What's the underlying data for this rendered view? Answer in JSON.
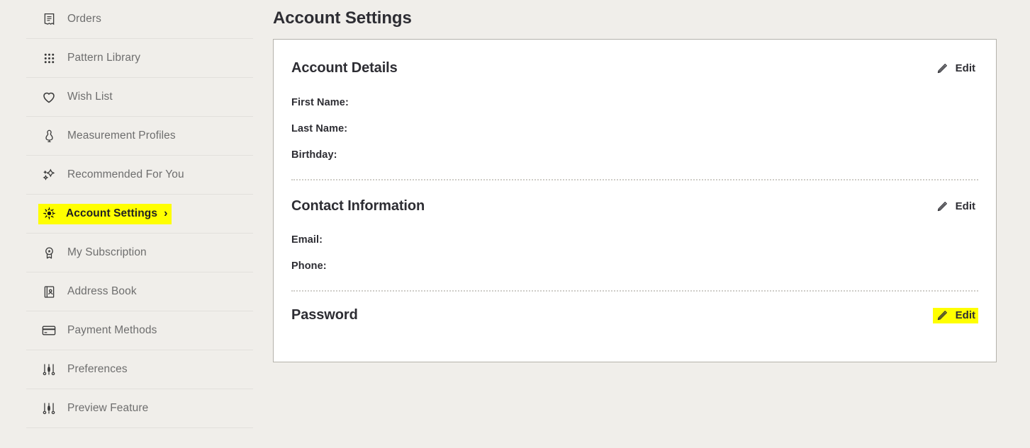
{
  "sidebar": {
    "items": [
      {
        "label": "Orders",
        "icon": "receipt-icon",
        "active": false
      },
      {
        "label": "Pattern Library",
        "icon": "grid-dots-icon",
        "active": false
      },
      {
        "label": "Wish List",
        "icon": "heart-icon",
        "active": false
      },
      {
        "label": "Measurement Profiles",
        "icon": "dress-form-icon",
        "active": false
      },
      {
        "label": "Recommended For You",
        "icon": "sparkles-icon",
        "active": false
      },
      {
        "label": "Account Settings",
        "icon": "gear-icon",
        "active": true,
        "chevron": "›"
      },
      {
        "label": "My Subscription",
        "icon": "award-ribbon-icon",
        "active": false
      },
      {
        "label": "Address Book",
        "icon": "address-book-icon",
        "active": false
      },
      {
        "label": "Payment Methods",
        "icon": "credit-card-icon",
        "active": false
      },
      {
        "label": "Preferences",
        "icon": "sliders-icon",
        "active": false
      },
      {
        "label": "Preview Feature",
        "icon": "sliders-icon",
        "active": false
      }
    ]
  },
  "main": {
    "page_title": "Account Settings",
    "sections": {
      "account_details": {
        "title": "Account Details",
        "edit_label": "Edit",
        "fields": [
          {
            "label": "First Name:",
            "value": ""
          },
          {
            "label": "Last Name:",
            "value": ""
          },
          {
            "label": "Birthday:",
            "value": ""
          }
        ]
      },
      "contact_information": {
        "title": "Contact Information",
        "edit_label": "Edit",
        "fields": [
          {
            "label": "Email:",
            "value": ""
          },
          {
            "label": "Phone:",
            "value": ""
          }
        ]
      },
      "password": {
        "title": "Password",
        "edit_label": "Edit"
      }
    }
  },
  "colors": {
    "page_background": "#f0eeea",
    "card_background": "#ffffff",
    "card_border": "#b4b2ab",
    "text_dark": "#2d2d33",
    "text_muted": "#6e6e6e",
    "highlight_yellow": "#ffff00",
    "divider": "#e2e0dc",
    "dotted_divider": "#cfcdc8"
  }
}
